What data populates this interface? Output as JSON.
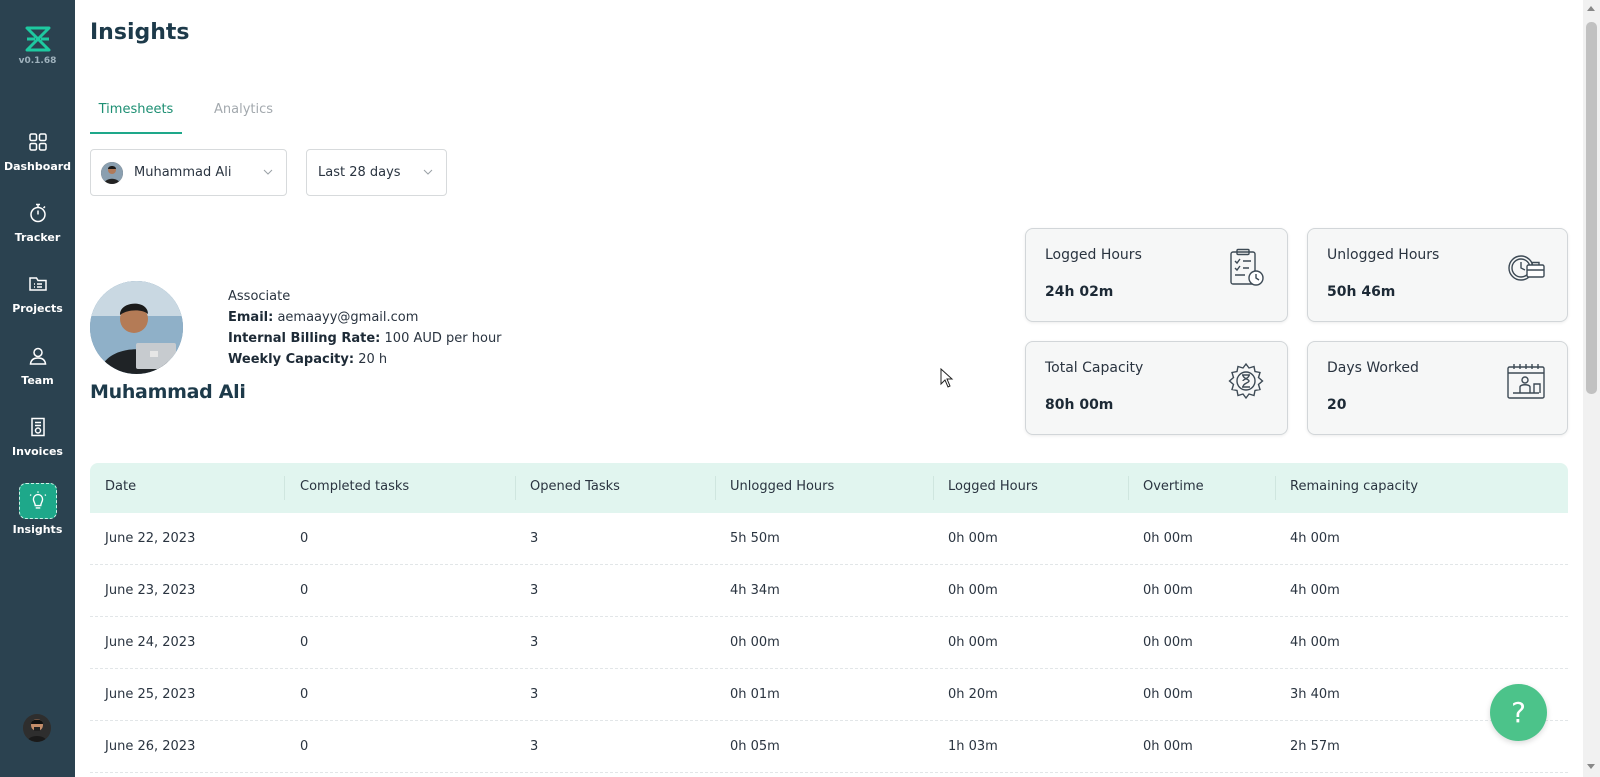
{
  "sidebar": {
    "version": "v0.1.68",
    "items": [
      {
        "label": "Dashboard",
        "icon": "grid-icon"
      },
      {
        "label": "Tracker",
        "icon": "stopwatch-icon"
      },
      {
        "label": "Projects",
        "icon": "folder-icon"
      },
      {
        "label": "Team",
        "icon": "user-icon"
      },
      {
        "label": "Invoices",
        "icon": "invoice-icon"
      },
      {
        "label": "Insights",
        "icon": "lightbulb-icon",
        "active": true
      }
    ]
  },
  "header": {
    "title": "Insights"
  },
  "tabs": [
    {
      "label": "Timesheets",
      "active": true
    },
    {
      "label": "Analytics",
      "active": false
    }
  ],
  "filters": {
    "user": "Muhammad Ali",
    "range": "Last 28 days"
  },
  "profile": {
    "name": "Muhammad Ali",
    "role": "Associate",
    "email_label": "Email:",
    "email": "aemaayy@gmail.com",
    "billing_label": "Internal Billing Rate:",
    "billing": "100 AUD per hour",
    "capacity_label": "Weekly Capacity:",
    "capacity": "20 h"
  },
  "stats": {
    "logged": {
      "label": "Logged Hours",
      "value": "24h 02m",
      "icon": "clipboard-clock-icon"
    },
    "unlogged": {
      "label": "Unlogged Hours",
      "value": "50h 46m",
      "icon": "briefcase-clock-icon"
    },
    "capacity": {
      "label": "Total Capacity",
      "value": "80h 00m",
      "icon": "gear-hourglass-icon"
    },
    "days": {
      "label": "Days Worked",
      "value": "20",
      "icon": "calendar-desk-icon"
    }
  },
  "table": {
    "columns": [
      "Date",
      "Completed tasks",
      "Opened Tasks",
      "Unlogged Hours",
      "Logged Hours",
      "Overtime",
      "Remaining capacity"
    ],
    "rows": [
      [
        "June 22, 2023",
        "0",
        "3",
        "5h 50m",
        "0h 00m",
        "0h 00m",
        "4h 00m"
      ],
      [
        "June 23, 2023",
        "0",
        "3",
        "4h 34m",
        "0h 00m",
        "0h 00m",
        "4h 00m"
      ],
      [
        "June 24, 2023",
        "0",
        "3",
        "0h 00m",
        "0h 00m",
        "0h 00m",
        "4h 00m"
      ],
      [
        "June 25, 2023",
        "0",
        "3",
        "0h 01m",
        "0h 20m",
        "0h 00m",
        "3h 40m"
      ],
      [
        "June 26, 2023",
        "0",
        "3",
        "0h 05m",
        "1h 03m",
        "0h 00m",
        "2h 57m"
      ]
    ]
  },
  "help": {
    "label": "?"
  },
  "colors": {
    "sidebar": "#2b4250",
    "accent": "#1ea88a",
    "table_header": "#e1f5ef",
    "help": "#4cc38a"
  }
}
